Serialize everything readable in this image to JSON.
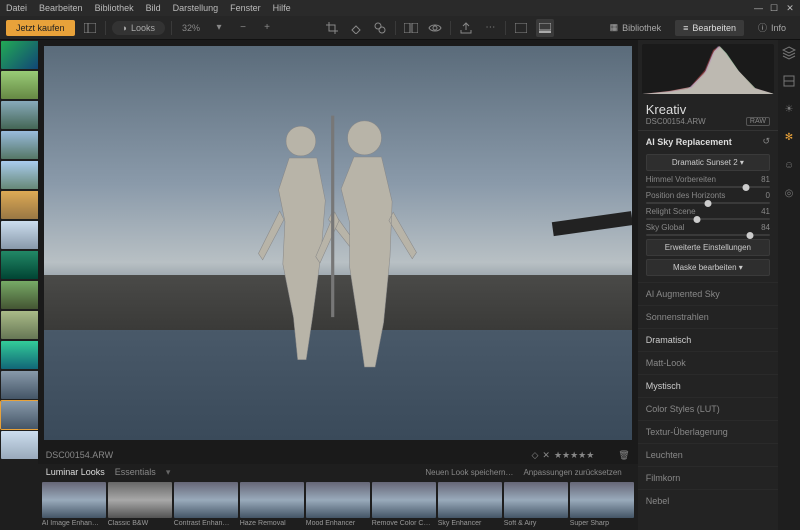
{
  "menu": {
    "items": [
      "Datei",
      "Bearbeiten",
      "Bibliothek",
      "Bild",
      "Darstellung",
      "Fenster",
      "Hilfe"
    ]
  },
  "toolbar": {
    "buy": "Jetzt kaufen",
    "looks": "Looks",
    "zoom": "32%",
    "modes": {
      "library": "Bibliothek",
      "edit": "Bearbeiten",
      "info": "Info"
    }
  },
  "file": {
    "name": "DSC00154.ARW"
  },
  "looksbar": {
    "tabs": {
      "luminar": "Luminar Looks",
      "essentials": "Essentials"
    },
    "items": [
      "AI Image Enhan…",
      "Classic B&W",
      "Contrast Enhan…",
      "Haze Removal",
      "Mood Enhancer",
      "Remove Color C…",
      "Sky Enhancer",
      "Soft & Airy",
      "Super Sharp"
    ],
    "save": "Neuen Look speichern…",
    "reset": "Anpassungen zurücksetzen"
  },
  "panel": {
    "title": "Kreativ",
    "filename": "DSC00154.ARW",
    "badge": "RAW",
    "activeTool": {
      "name": "AI Sky Replacement",
      "dropdown": "Dramatic Sunset 2 ▾",
      "sliders": [
        {
          "label": "Himmel Vorbereiten",
          "value": 81,
          "pos": 81
        },
        {
          "label": "Position des Horizonts",
          "value": 0,
          "pos": 50
        },
        {
          "label": "Relight Scene",
          "value": 41,
          "pos": 41
        },
        {
          "label": "Sky Global",
          "value": 84,
          "pos": 84
        }
      ],
      "advanced": "Erweiterte Einstellungen",
      "mask": "Maske bearbeiten ▾"
    },
    "tools": [
      {
        "label": "AI Augmented Sky",
        "hl": false
      },
      {
        "label": "Sonnenstrahlen",
        "hl": false
      },
      {
        "label": "Dramatisch",
        "hl": true
      },
      {
        "label": "Matt-Look",
        "hl": false
      },
      {
        "label": "Mystisch",
        "hl": true
      },
      {
        "label": "Color Styles (LUT)",
        "hl": false
      },
      {
        "label": "Textur-Überlagerung",
        "hl": false
      },
      {
        "label": "Leuchten",
        "hl": false
      },
      {
        "label": "Filmkorn",
        "hl": false
      },
      {
        "label": "Nebel",
        "hl": false
      }
    ]
  }
}
